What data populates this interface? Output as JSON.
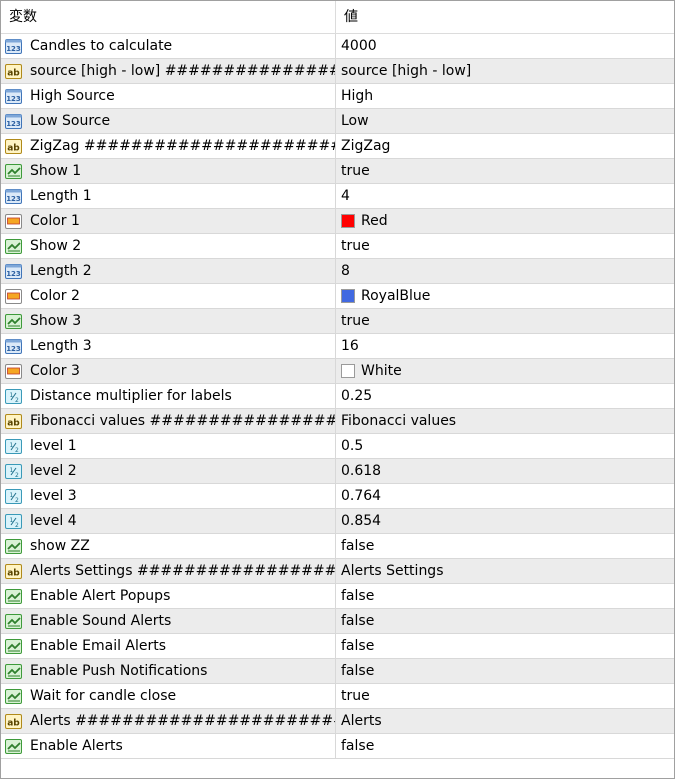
{
  "header": {
    "name_col": "変数",
    "value_col": "値"
  },
  "rows": [
    {
      "icon": "int-icon",
      "name": "Candles to calculate",
      "value": "4000"
    },
    {
      "icon": "string-icon",
      "name": "source [high - low] ###################...",
      "value": "source [high - low]"
    },
    {
      "icon": "int-icon",
      "name": "High Source",
      "value": "High"
    },
    {
      "icon": "int-icon",
      "name": "Low Source",
      "value": "Low"
    },
    {
      "icon": "string-icon",
      "name": "ZigZag #############################...",
      "value": "ZigZag"
    },
    {
      "icon": "bool-icon",
      "name": "Show 1",
      "value": "true"
    },
    {
      "icon": "int-icon",
      "name": "Length 1",
      "value": "4"
    },
    {
      "icon": "color-icon",
      "name": "Color 1",
      "value": "Red",
      "color": "#ff0000"
    },
    {
      "icon": "bool-icon",
      "name": "Show 2",
      "value": "true"
    },
    {
      "icon": "int-icon",
      "name": "Length 2",
      "value": "8"
    },
    {
      "icon": "color-icon",
      "name": "Color 2",
      "value": "RoyalBlue",
      "color": "#4169e1"
    },
    {
      "icon": "bool-icon",
      "name": "Show 3",
      "value": "true"
    },
    {
      "icon": "int-icon",
      "name": "Length 3",
      "value": "16"
    },
    {
      "icon": "color-icon",
      "name": "Color 3",
      "value": "White",
      "color": "#ffffff"
    },
    {
      "icon": "double-icon",
      "name": "Distance multiplier for labels",
      "value": "0.25"
    },
    {
      "icon": "string-icon",
      "name": "Fibonacci values #######################...",
      "value": "Fibonacci values"
    },
    {
      "icon": "double-icon",
      "name": "level 1",
      "value": "0.5"
    },
    {
      "icon": "double-icon",
      "name": "level 2",
      "value": "0.618"
    },
    {
      "icon": "double-icon",
      "name": "level 3",
      "value": "0.764"
    },
    {
      "icon": "double-icon",
      "name": "level 4",
      "value": "0.854"
    },
    {
      "icon": "bool-icon",
      "name": "show ZZ",
      "value": "false"
    },
    {
      "icon": "string-icon",
      "name": "Alerts Settings #######################...",
      "value": "Alerts Settings"
    },
    {
      "icon": "bool-icon",
      "name": "Enable Alert Popups",
      "value": "false"
    },
    {
      "icon": "bool-icon",
      "name": "Enable Sound Alerts",
      "value": "false"
    },
    {
      "icon": "bool-icon",
      "name": "Enable Email Alerts",
      "value": "false"
    },
    {
      "icon": "bool-icon",
      "name": "Enable Push Notifications",
      "value": "false"
    },
    {
      "icon": "bool-icon",
      "name": "Wait for candle close",
      "value": "true"
    },
    {
      "icon": "string-icon",
      "name": "Alerts ##############################...",
      "value": "Alerts"
    },
    {
      "icon": "bool-icon",
      "name": "Enable Alerts",
      "value": "false"
    }
  ]
}
